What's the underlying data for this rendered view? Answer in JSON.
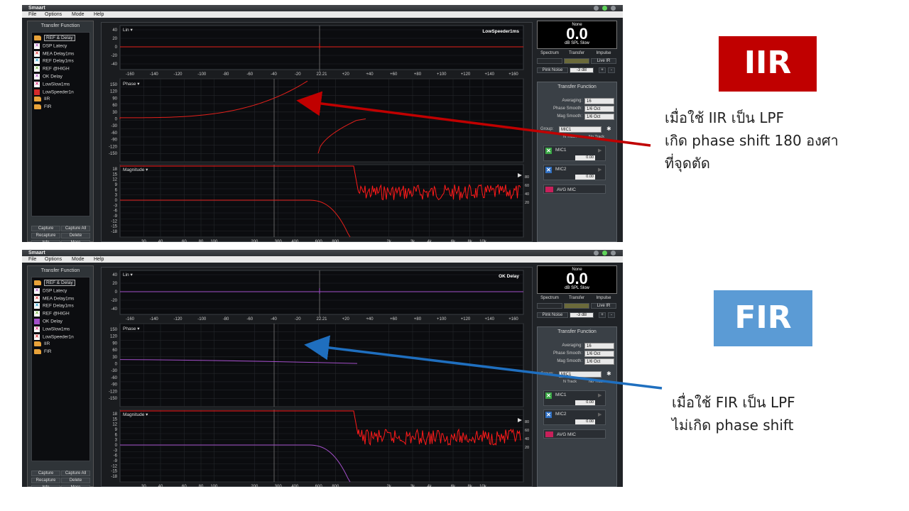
{
  "windows": [
    {
      "title": "Smaart",
      "menu": [
        "File",
        "Options",
        "Mode",
        "Help"
      ],
      "sidebar": {
        "header": "Transfer Function",
        "items": [
          {
            "label": "REF & Delay",
            "icon": "folder-icon",
            "color": "#e8a23a",
            "selected": true
          },
          {
            "label": "DSP Latecy",
            "icon": "x-icon",
            "color": "#b55fc7"
          },
          {
            "label": "MEA Delay1ms",
            "icon": "x-icon",
            "color": "#e04040"
          },
          {
            "label": "REF Delay1ms",
            "icon": "x-icon",
            "color": "#2aa7d8"
          },
          {
            "label": "REF @HIGH",
            "icon": "x-icon",
            "color": "#7ab648"
          },
          {
            "label": "OK Delay",
            "icon": "x-icon",
            "color": "#b55fc7"
          },
          {
            "label": "LowSlow1ms",
            "icon": "x-icon",
            "color": "#d9307b"
          },
          {
            "label": "LowSpeeder1n",
            "icon": "swatch-icon",
            "color": "#d42a2a"
          },
          {
            "label": "IIR",
            "icon": "folder-icon",
            "color": "#e8a23a"
          },
          {
            "label": "FIR",
            "icon": "folder-icon",
            "color": "#e8a23a"
          }
        ],
        "buttons": [
          "Capture",
          "Capture All",
          "Recapture",
          "Delete",
          "Info",
          "More"
        ]
      },
      "trace_label": "LowSpeeder1ms",
      "trace_color": "#e3201b",
      "mag_color": "#e3201b",
      "phase_shape": "iir"
    },
    {
      "title": "Smaart",
      "menu": [
        "File",
        "Options",
        "Mode",
        "Help"
      ],
      "sidebar": {
        "header": "Transfer Function",
        "items": [
          {
            "label": "REF & Delay",
            "icon": "folder-icon",
            "color": "#e8a23a",
            "selected": true
          },
          {
            "label": "DSP Latecy",
            "icon": "x-icon",
            "color": "#b55fc7"
          },
          {
            "label": "MEA Delay1ms",
            "icon": "x-icon",
            "color": "#e04040"
          },
          {
            "label": "REF Delay1ms",
            "icon": "x-icon",
            "color": "#2aa7d8"
          },
          {
            "label": "REF @HIGH",
            "icon": "x-icon",
            "color": "#7ab648"
          },
          {
            "label": "OK Delay",
            "icon": "swatch-icon",
            "color": "#a34fc9"
          },
          {
            "label": "LowSlow1ms",
            "icon": "x-icon",
            "color": "#d9307b"
          },
          {
            "label": "LowSpeeder1n",
            "icon": "x-icon",
            "color": "#d42a2a"
          },
          {
            "label": "IIR",
            "icon": "folder-icon",
            "color": "#e8a23a"
          },
          {
            "label": "FIR",
            "icon": "folder-icon",
            "color": "#e8a23a"
          }
        ],
        "buttons": [
          "Capture",
          "Capture All",
          "Recapture",
          "Delete",
          "Info",
          "More"
        ]
      },
      "trace_label": "OK Delay",
      "trace_color": "#a34fc9",
      "mag_color": "#a34fc9",
      "phase_shape": "fir"
    }
  ],
  "common": {
    "spl": {
      "top": "None",
      "value": "0.0",
      "unit": "dB SPL Slow"
    },
    "modes": [
      "Spectrum",
      "Transfer",
      "Impulse"
    ],
    "live_label": "Live IR",
    "pink_noise": "Pink Noise",
    "noise_level": "-3 dB",
    "plus": "+",
    "minus": "-",
    "panel_title": "Transfer Function",
    "averaging_label": "Averaging:",
    "averaging_value": "16",
    "phase_smooth_label": "Phase Smooth:",
    "phase_smooth_value": "1/6 Oct",
    "mag_smooth_label": "Mag Smooth:",
    "mag_smooth_value": "1/6 Oct",
    "group_label": "Group:",
    "group_value": "MIC1",
    "track_a": "N Track",
    "track_b": "No Track",
    "mics": [
      {
        "name": "MIC1",
        "value": "0.00",
        "color": "#3aa845"
      },
      {
        "name": "MIC2",
        "value": "0.00",
        "color": "#2f6fc2"
      }
    ],
    "avg_mic": "AVG MIC",
    "lin_label": "Lin ▾",
    "lin_ticks": [
      "40",
      "20",
      "0",
      "-20",
      "-40"
    ],
    "ir_xticks": [
      "-160",
      "-140",
      "-120",
      "-100",
      "-80",
      "-60",
      "-40",
      "-20",
      "22.21",
      "+20",
      "+40",
      "+60",
      "+80",
      "+100",
      "+120",
      "+140",
      "+160"
    ],
    "phase_label": "Phase ▾",
    "phase_ticks": [
      "150",
      "120",
      "90",
      "60",
      "30",
      "0",
      "-30",
      "-60",
      "-90",
      "-120",
      "-150"
    ],
    "freq_ticks": [
      "30",
      "40",
      "60",
      "80",
      "100",
      "200",
      "300",
      "400",
      "600",
      "800",
      "2k",
      "3k",
      "4k",
      "6k",
      "8k",
      "10k"
    ],
    "mag_label": "Magnitude ▾",
    "mag_ticks": [
      "18",
      "15",
      "12",
      "9",
      "6",
      "3",
      "0",
      "-3",
      "-6",
      "-9",
      "-12",
      "-15",
      "-18"
    ],
    "coh_ticks": [
      "80",
      "60",
      "40",
      "20"
    ]
  },
  "annotations": {
    "iir": {
      "badge": "IIR",
      "badge_color": "#c00000",
      "line1": "เมื่อใช้ IIR เป็น LPF",
      "line2": "เกิด phase shift 180 องศา",
      "line3": "ที่จุดตัด",
      "arrow_color": "#c00000"
    },
    "fir": {
      "badge": "FIR",
      "badge_color": "#5b9bd5",
      "line1": "เมื่อใช้ FIR เป็น LPF",
      "line2": "ไม่เกิด phase shift",
      "arrow_color": "#1f6fbf"
    }
  }
}
